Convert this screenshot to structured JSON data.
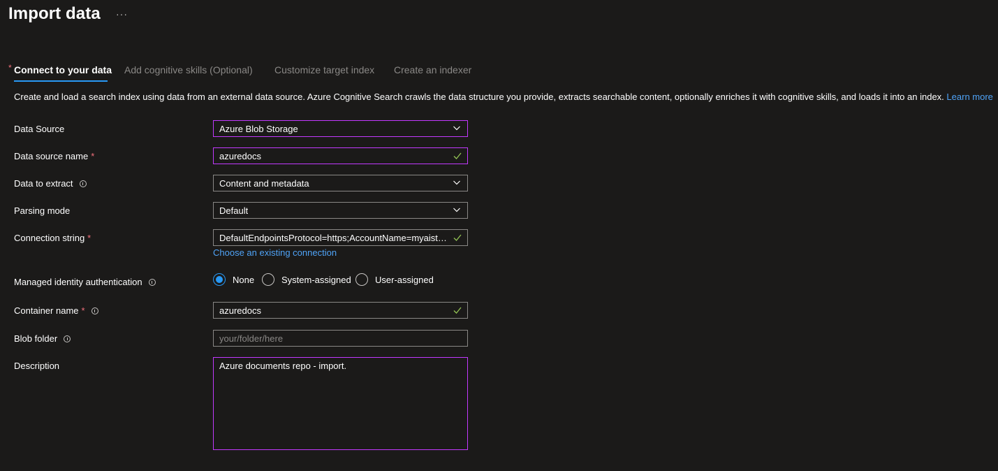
{
  "page": {
    "title": "Import data",
    "more_glyph": "···"
  },
  "tabs": [
    {
      "label": "Connect to your data",
      "active": true,
      "required": true
    },
    {
      "label": "Add cognitive skills (Optional)",
      "active": false
    },
    {
      "label": "Customize target index",
      "active": false
    },
    {
      "label": "Create an indexer",
      "active": false
    }
  ],
  "intro": {
    "text": "Create and load a search index using data from an external data source. Azure Cognitive Search crawls the data structure you provide, extracts searchable content, optionally enriches it with cognitive skills, and loads it into an index.",
    "link": "Learn more"
  },
  "form": {
    "data_source": {
      "label": "Data Source",
      "value": "Azure Blob Storage"
    },
    "data_source_name": {
      "label": "Data source name",
      "value": "azuredocs"
    },
    "data_to_extract": {
      "label": "Data to extract",
      "value": "Content and metadata"
    },
    "parsing_mode": {
      "label": "Parsing mode",
      "value": "Default"
    },
    "connection_string": {
      "label": "Connection string",
      "value": "DefaultEndpointsProtocol=https;AccountName=myaistg...",
      "link": "Choose an existing connection"
    },
    "managed_identity": {
      "label": "Managed identity authentication",
      "options": [
        "None",
        "System-assigned",
        "User-assigned"
      ],
      "selected": "None"
    },
    "container_name": {
      "label": "Container name",
      "value": "azuredocs"
    },
    "blob_folder": {
      "label": "Blob folder",
      "placeholder": "your/folder/here"
    },
    "description": {
      "label": "Description",
      "value": "Azure documents repo - import."
    }
  },
  "required_marker": "*",
  "colors": {
    "background": "#1b1a19",
    "accent": "#2899f5",
    "focus_border": "#c239ff",
    "link": "#4fa3f7",
    "required": "#f1707b",
    "valid_check": "#92c353"
  },
  "icons": {
    "dropdown": "chevron-down-icon",
    "valid": "checkmark-icon",
    "info": "info-icon"
  }
}
